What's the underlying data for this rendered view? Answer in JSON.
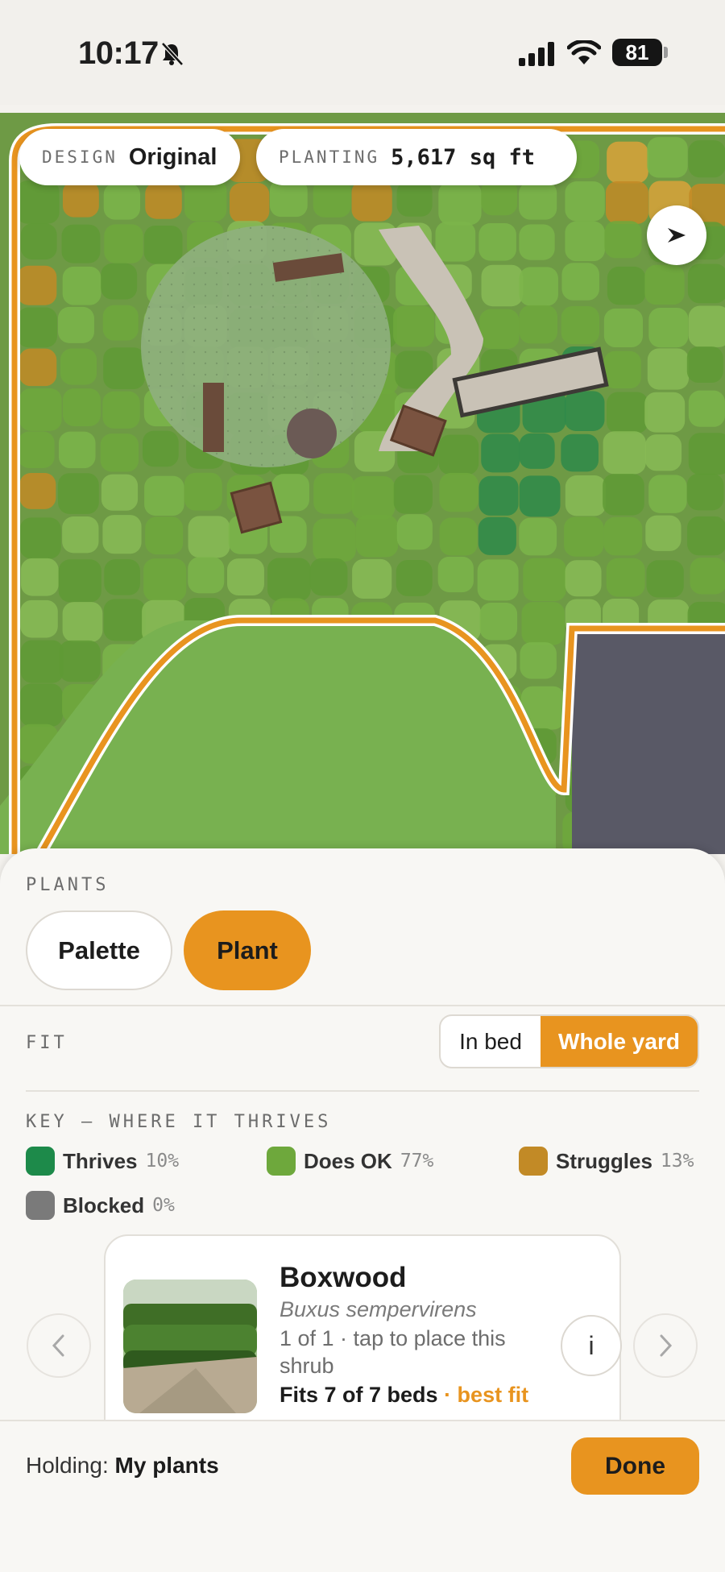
{
  "status_bar": {
    "time": "10:17",
    "battery": "81"
  },
  "map_header": {
    "design_label": "DESIGN",
    "design_value": "Original",
    "planting_label": "PLANTING",
    "planting_value": "5,617 sq ft"
  },
  "plants_section": {
    "label": "PLANTS",
    "palette_button": "Palette",
    "plant_button": "Plant",
    "active_mode": "Plant"
  },
  "fit": {
    "label": "FIT",
    "options": [
      "In bed",
      "Whole yard"
    ],
    "selected": "Whole yard"
  },
  "key": {
    "label": "KEY — WHERE IT THRIVES",
    "items": [
      {
        "name": "Thrives",
        "pct": "10%",
        "color": "#1d8a4a"
      },
      {
        "name": "Does OK",
        "pct": "77%",
        "color": "#6ea83c"
      },
      {
        "name": "Struggles",
        "pct": "13%",
        "color": "#c28a26"
      },
      {
        "name": "Blocked",
        "pct": "0%",
        "color": "#7a7a7a"
      }
    ]
  },
  "plant_card": {
    "name": "Boxwood",
    "latin": "Buxus sempervirens",
    "count_text": "1 of 1 · tap to place this shrub",
    "fit_text": "Fits 7 of 7 beds",
    "fit_accent": "· best fit",
    "info_label": "i"
  },
  "footer": {
    "holding_label": "Holding:",
    "holding_value": "My plants",
    "done_button": "Done"
  },
  "colors": {
    "accent": "#e8941f",
    "sheet_bg": "#f8f7f4"
  }
}
